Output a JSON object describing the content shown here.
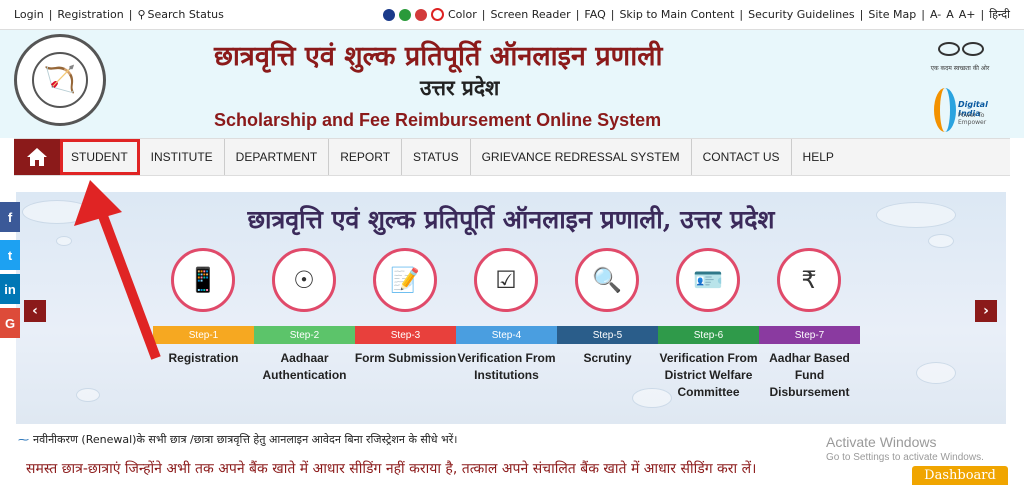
{
  "topbar": {
    "login": "Login",
    "registration": "Registration",
    "search": "Search Status",
    "color_label": "Color",
    "screen_reader": "Screen Reader",
    "faq": "FAQ",
    "skip": "Skip to Main Content",
    "security": "Security Guidelines",
    "sitemap": "Site Map",
    "font_minus": "A-",
    "font_normal": "A",
    "font_plus": "A+",
    "hindi": "हिन्दी",
    "theme_colors": [
      "#1a3a8a",
      "#2a9a3a",
      "#d23a3a"
    ]
  },
  "header": {
    "title_hi": "छात्रवृत्ति एवं शुल्क प्रतिपूर्ति ऑनलाइन प्रणाली",
    "subtitle_hi": "उत्तर प्रदेश",
    "title_en": "Scholarship and Fee Reimbursement Online System",
    "swachh_caption": "एक कदम स्वच्छता की ओर",
    "digital_india": "Digital India",
    "digital_tagline": "Power To Empower"
  },
  "nav": {
    "items": [
      "STUDENT",
      "INSTITUTE",
      "DEPARTMENT",
      "REPORT",
      "STATUS",
      "GRIEVANCE REDRESSAL SYSTEM",
      "CONTACT US",
      "HELP"
    ]
  },
  "banner": {
    "title": "छात्रवृत्ति एवं शुल्क प्रतिपूर्ति ऑनलाइन प्रणाली, उत्तर प्रदेश",
    "steps": [
      {
        "step": "Step-1",
        "label": "Registration",
        "color": "#f6a821"
      },
      {
        "step": "Step-2",
        "label": "Aadhaar Authentication",
        "color": "#5cc46a"
      },
      {
        "step": "Step-3",
        "label": "Form Submission",
        "color": "#e8403c"
      },
      {
        "step": "Step-4",
        "label": "Verification From Institutions",
        "color": "#4a9ee0"
      },
      {
        "step": "Step-5",
        "label": "Scrutiny",
        "color": "#2a5d8a"
      },
      {
        "step": "Step-6",
        "label": "Verification From District Welfare Committee",
        "color": "#2f9a4a"
      },
      {
        "step": "Step-7",
        "label": "Aadhar Based Fund Disbursement",
        "color": "#8a3aa0"
      }
    ]
  },
  "social": {
    "facebook": "f",
    "twitter": "t",
    "linkedin": "in",
    "google": "G"
  },
  "renewal": "नवीनीकरण (Renewal)के सभी छात्र /छात्रा छात्रवृत्ति हेतु आनलाइन आवेदन बिना रजिस्ट्रेशन के सीधे भरें।",
  "notice": "समस्त छात्र-छात्राएं जिन्होंने अभी तक अपने बैंक खाते में आधार सीडिंग नहीं कराया है, तत्काल अपने संचालित बैंक खाते में आधार सीडिंग करा लें।",
  "activate": {
    "line1": "Activate Windows",
    "line2": "Go to Settings to activate Windows."
  },
  "dashboard": "Dashboard"
}
